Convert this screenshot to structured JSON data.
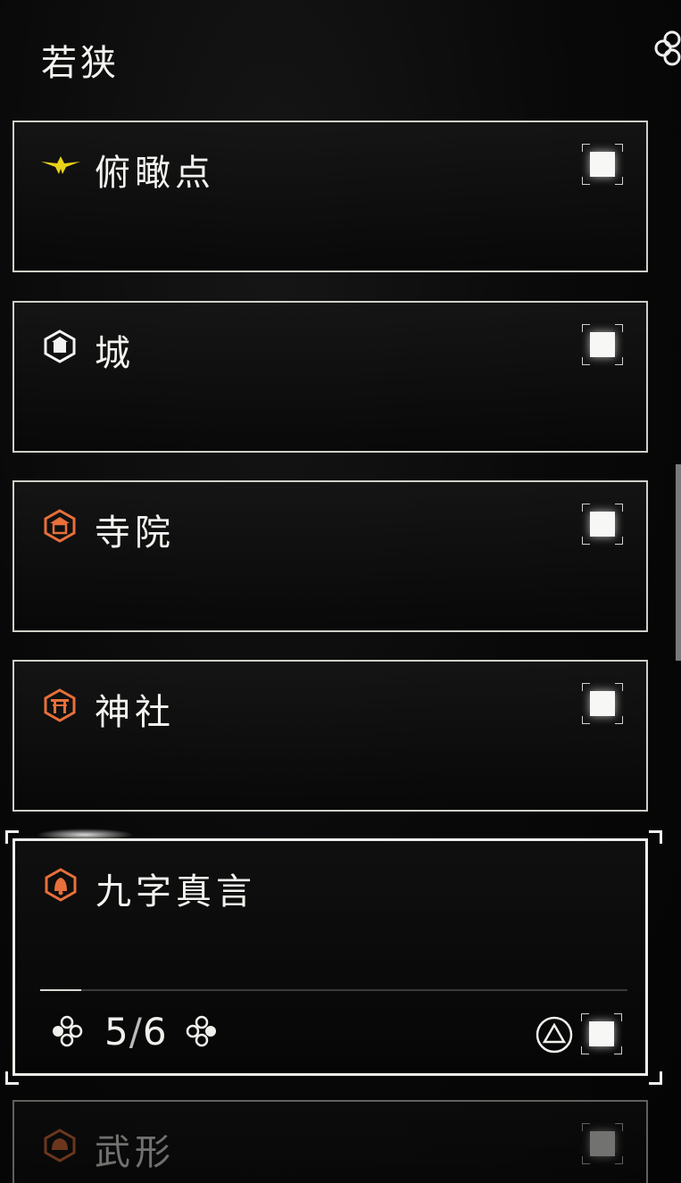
{
  "region": {
    "title": "若狭"
  },
  "categories": [
    {
      "label": "俯瞰点",
      "icon": "golden-bird-icon",
      "icon_color": "#e8d21a",
      "checked": true
    },
    {
      "label": "城",
      "icon": "castle-icon",
      "icon_color": "#f2f2f2",
      "checked": true
    },
    {
      "label": "寺院",
      "icon": "temple-icon",
      "icon_color": "#e8703a",
      "checked": true
    },
    {
      "label": "神社",
      "icon": "shrine-icon",
      "icon_color": "#e8703a",
      "checked": true
    },
    {
      "label": "九字真言",
      "icon": "bell-icon",
      "icon_color": "#e8703a",
      "checked": true,
      "selected": true,
      "found": "5",
      "separator": "/",
      "total": "6",
      "progress": 0.07
    },
    {
      "label": "武形",
      "icon": "helmet-icon",
      "icon_color": "#e8703a",
      "checked": true
    }
  ],
  "controls": {
    "left_button": "dpad-left-icon",
    "right_button": "dpad-right-icon",
    "toggle_button": "triangle-button-icon"
  },
  "colors": {
    "accent_orange": "#e8703a",
    "gold": "#e8d21a",
    "frame": "#cfcfc8"
  }
}
